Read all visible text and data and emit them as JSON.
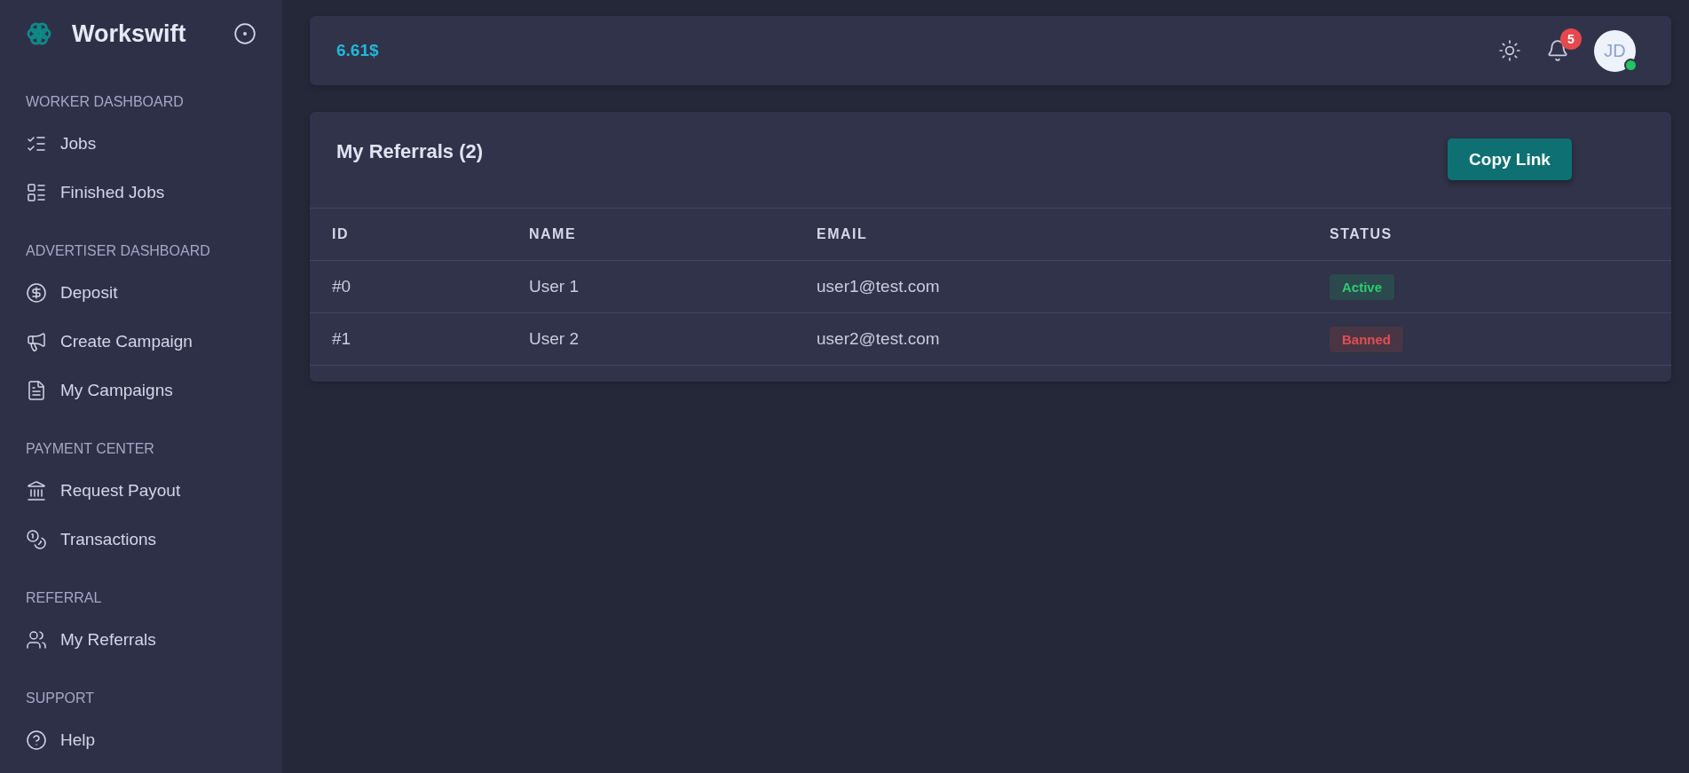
{
  "sidebar": {
    "brand": "Workswift",
    "sections": [
      {
        "title": "WORKER DASHBOARD",
        "items": [
          {
            "label": "Jobs",
            "kind": "jobs"
          },
          {
            "label": "Finished Jobs",
            "kind": "finished"
          }
        ]
      },
      {
        "title": "ADVERTISER DASHBOARD",
        "items": [
          {
            "label": "Deposit",
            "kind": "deposit"
          },
          {
            "label": "Create Campaign",
            "kind": "campaign"
          },
          {
            "label": "My Campaigns",
            "kind": "campaigns"
          }
        ]
      },
      {
        "title": "PAYMENT CENTER",
        "items": [
          {
            "label": "Request Payout",
            "kind": "payout"
          },
          {
            "label": "Transactions",
            "kind": "transactions"
          }
        ]
      },
      {
        "title": "REFERRAL",
        "items": [
          {
            "label": "My Referrals",
            "kind": "referrals"
          }
        ]
      },
      {
        "title": "SUPPORT",
        "items": [
          {
            "label": "Help",
            "kind": "help"
          }
        ]
      }
    ]
  },
  "header": {
    "balance": "6.61$",
    "notification_count": "5",
    "avatar_initials": "JD",
    "online": true
  },
  "referrals": {
    "title": "My Referrals (2)",
    "copy_button": "Copy Link",
    "table": {
      "columns": [
        "ID",
        "NAME",
        "EMAIL",
        "STATUS"
      ],
      "rows": [
        {
          "id": "#0",
          "name": "User 1",
          "email": "user1@test.com",
          "status": "Active",
          "kind": "active"
        },
        {
          "id": "#1",
          "name": "User 2",
          "email": "user2@test.com",
          "status": "Banned",
          "kind": "banned"
        }
      ]
    }
  }
}
